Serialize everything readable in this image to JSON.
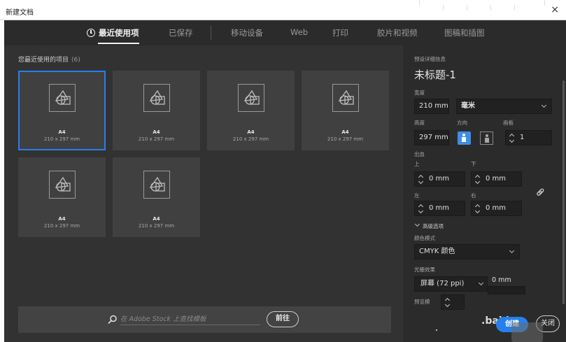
{
  "window": {
    "title": "新建文档",
    "close_glyph": "×"
  },
  "tabs": [
    {
      "label": "最近使用项",
      "active": true,
      "icon": "clock-icon"
    },
    {
      "label": "已保存",
      "active": false
    },
    {
      "label": "移动设备",
      "active": false
    },
    {
      "label": "Web",
      "active": false
    },
    {
      "label": "打印",
      "active": false
    },
    {
      "label": "胶片和视频",
      "active": false
    },
    {
      "label": "图稿和插图",
      "active": false
    }
  ],
  "recent": {
    "title": "您最近使用的项目",
    "count": "(6)",
    "items": [
      {
        "name": "A4",
        "size": "210 x 297 mm",
        "selected": true
      },
      {
        "name": "A4",
        "size": "210 x 297 mm",
        "selected": false
      },
      {
        "name": "A4",
        "size": "210 x 297 mm",
        "selected": false
      },
      {
        "name": "A4",
        "size": "210 x 297 mm",
        "selected": false
      },
      {
        "name": "A4",
        "size": "210 x 297 mm",
        "selected": false
      },
      {
        "name": "A4",
        "size": "210 x 297 mm",
        "selected": false
      }
    ]
  },
  "search": {
    "placeholder": "在 Adobe Stock 上查找模板",
    "go_label": "前往"
  },
  "preset": {
    "section_title": "预设详细信息",
    "doc_name": "未标题-1",
    "width_label": "宽度",
    "width_value": "210 mm",
    "unit_value": "毫米",
    "height_label": "高度",
    "height_value": "297 mm",
    "orientation_label": "方向",
    "artboard_label": "画板",
    "artboard_value": "1",
    "bleed_label": "出血",
    "bleed_top_label": "上",
    "bleed_top_value": "0 mm",
    "bleed_bottom_label": "下",
    "bleed_bottom_value": "0 mm",
    "bleed_left_label": "左",
    "bleed_left_value": "0 mm",
    "bleed_right_label": "右",
    "bleed_right_value": "0 mm",
    "advanced_label": "高级选项",
    "color_mode_label": "颜色模式",
    "color_mode_value": "CMYK 颜色",
    "raster_label": "光栅效果",
    "raster_value": "屏幕 (72 ppi)",
    "raster_extra": "0 mm",
    "preview_label": "预览模",
    "create_label": "创建",
    "close_label": "关闭",
    "watermark_text": ".baidu"
  },
  "colors": {
    "accent": "#2680eb",
    "panel": "#323232",
    "card": "#404040"
  }
}
